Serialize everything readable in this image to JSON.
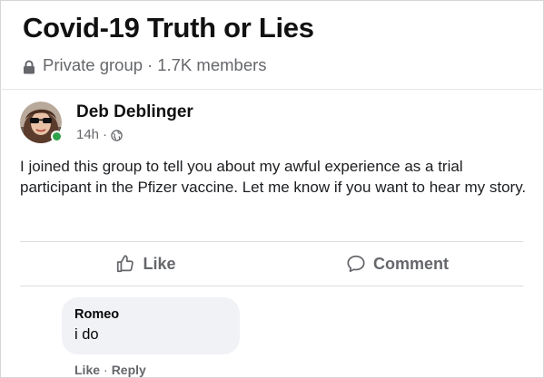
{
  "group": {
    "title": "Covid-19 Truth or Lies",
    "privacy": "Private group",
    "separator": "·",
    "members": "1.7K members"
  },
  "post": {
    "author": "Deb Deblinger",
    "time": "14h",
    "time_separator": "·",
    "audience_icon": "globe-icon",
    "online_status_color": "#31a24c",
    "body": "I joined this group to tell you about my awful experience as a trial participant in the Pfizer vaccine. Let me know if you want to hear my story."
  },
  "actions": {
    "like_label": "Like",
    "like_icon": "thumbs-up-icon",
    "comment_label": "Comment",
    "comment_icon": "speech-bubble-icon"
  },
  "comments": [
    {
      "author": "Romeo",
      "text": "i do",
      "like_label": "Like",
      "separator": "·",
      "reply_label": "Reply"
    }
  ]
}
